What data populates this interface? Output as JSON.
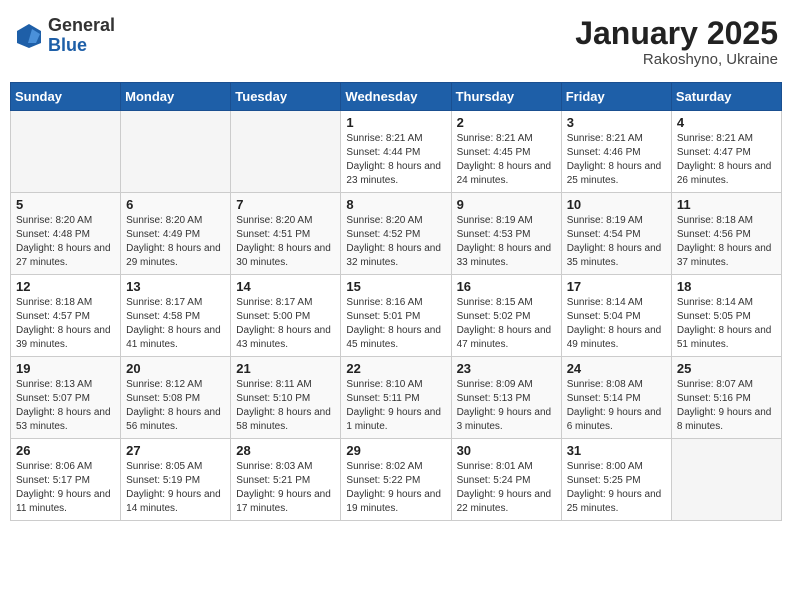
{
  "header": {
    "logo_general": "General",
    "logo_blue": "Blue",
    "month_title": "January 2025",
    "location": "Rakoshyno, Ukraine"
  },
  "weekdays": [
    "Sunday",
    "Monday",
    "Tuesday",
    "Wednesday",
    "Thursday",
    "Friday",
    "Saturday"
  ],
  "weeks": [
    [
      {
        "day": "",
        "info": ""
      },
      {
        "day": "",
        "info": ""
      },
      {
        "day": "",
        "info": ""
      },
      {
        "day": "1",
        "info": "Sunrise: 8:21 AM\nSunset: 4:44 PM\nDaylight: 8 hours and 23 minutes."
      },
      {
        "day": "2",
        "info": "Sunrise: 8:21 AM\nSunset: 4:45 PM\nDaylight: 8 hours and 24 minutes."
      },
      {
        "day": "3",
        "info": "Sunrise: 8:21 AM\nSunset: 4:46 PM\nDaylight: 8 hours and 25 minutes."
      },
      {
        "day": "4",
        "info": "Sunrise: 8:21 AM\nSunset: 4:47 PM\nDaylight: 8 hours and 26 minutes."
      }
    ],
    [
      {
        "day": "5",
        "info": "Sunrise: 8:20 AM\nSunset: 4:48 PM\nDaylight: 8 hours and 27 minutes."
      },
      {
        "day": "6",
        "info": "Sunrise: 8:20 AM\nSunset: 4:49 PM\nDaylight: 8 hours and 29 minutes."
      },
      {
        "day": "7",
        "info": "Sunrise: 8:20 AM\nSunset: 4:51 PM\nDaylight: 8 hours and 30 minutes."
      },
      {
        "day": "8",
        "info": "Sunrise: 8:20 AM\nSunset: 4:52 PM\nDaylight: 8 hours and 32 minutes."
      },
      {
        "day": "9",
        "info": "Sunrise: 8:19 AM\nSunset: 4:53 PM\nDaylight: 8 hours and 33 minutes."
      },
      {
        "day": "10",
        "info": "Sunrise: 8:19 AM\nSunset: 4:54 PM\nDaylight: 8 hours and 35 minutes."
      },
      {
        "day": "11",
        "info": "Sunrise: 8:18 AM\nSunset: 4:56 PM\nDaylight: 8 hours and 37 minutes."
      }
    ],
    [
      {
        "day": "12",
        "info": "Sunrise: 8:18 AM\nSunset: 4:57 PM\nDaylight: 8 hours and 39 minutes."
      },
      {
        "day": "13",
        "info": "Sunrise: 8:17 AM\nSunset: 4:58 PM\nDaylight: 8 hours and 41 minutes."
      },
      {
        "day": "14",
        "info": "Sunrise: 8:17 AM\nSunset: 5:00 PM\nDaylight: 8 hours and 43 minutes."
      },
      {
        "day": "15",
        "info": "Sunrise: 8:16 AM\nSunset: 5:01 PM\nDaylight: 8 hours and 45 minutes."
      },
      {
        "day": "16",
        "info": "Sunrise: 8:15 AM\nSunset: 5:02 PM\nDaylight: 8 hours and 47 minutes."
      },
      {
        "day": "17",
        "info": "Sunrise: 8:14 AM\nSunset: 5:04 PM\nDaylight: 8 hours and 49 minutes."
      },
      {
        "day": "18",
        "info": "Sunrise: 8:14 AM\nSunset: 5:05 PM\nDaylight: 8 hours and 51 minutes."
      }
    ],
    [
      {
        "day": "19",
        "info": "Sunrise: 8:13 AM\nSunset: 5:07 PM\nDaylight: 8 hours and 53 minutes."
      },
      {
        "day": "20",
        "info": "Sunrise: 8:12 AM\nSunset: 5:08 PM\nDaylight: 8 hours and 56 minutes."
      },
      {
        "day": "21",
        "info": "Sunrise: 8:11 AM\nSunset: 5:10 PM\nDaylight: 8 hours and 58 minutes."
      },
      {
        "day": "22",
        "info": "Sunrise: 8:10 AM\nSunset: 5:11 PM\nDaylight: 9 hours and 1 minute."
      },
      {
        "day": "23",
        "info": "Sunrise: 8:09 AM\nSunset: 5:13 PM\nDaylight: 9 hours and 3 minutes."
      },
      {
        "day": "24",
        "info": "Sunrise: 8:08 AM\nSunset: 5:14 PM\nDaylight: 9 hours and 6 minutes."
      },
      {
        "day": "25",
        "info": "Sunrise: 8:07 AM\nSunset: 5:16 PM\nDaylight: 9 hours and 8 minutes."
      }
    ],
    [
      {
        "day": "26",
        "info": "Sunrise: 8:06 AM\nSunset: 5:17 PM\nDaylight: 9 hours and 11 minutes."
      },
      {
        "day": "27",
        "info": "Sunrise: 8:05 AM\nSunset: 5:19 PM\nDaylight: 9 hours and 14 minutes."
      },
      {
        "day": "28",
        "info": "Sunrise: 8:03 AM\nSunset: 5:21 PM\nDaylight: 9 hours and 17 minutes."
      },
      {
        "day": "29",
        "info": "Sunrise: 8:02 AM\nSunset: 5:22 PM\nDaylight: 9 hours and 19 minutes."
      },
      {
        "day": "30",
        "info": "Sunrise: 8:01 AM\nSunset: 5:24 PM\nDaylight: 9 hours and 22 minutes."
      },
      {
        "day": "31",
        "info": "Sunrise: 8:00 AM\nSunset: 5:25 PM\nDaylight: 9 hours and 25 minutes."
      },
      {
        "day": "",
        "info": ""
      }
    ]
  ]
}
